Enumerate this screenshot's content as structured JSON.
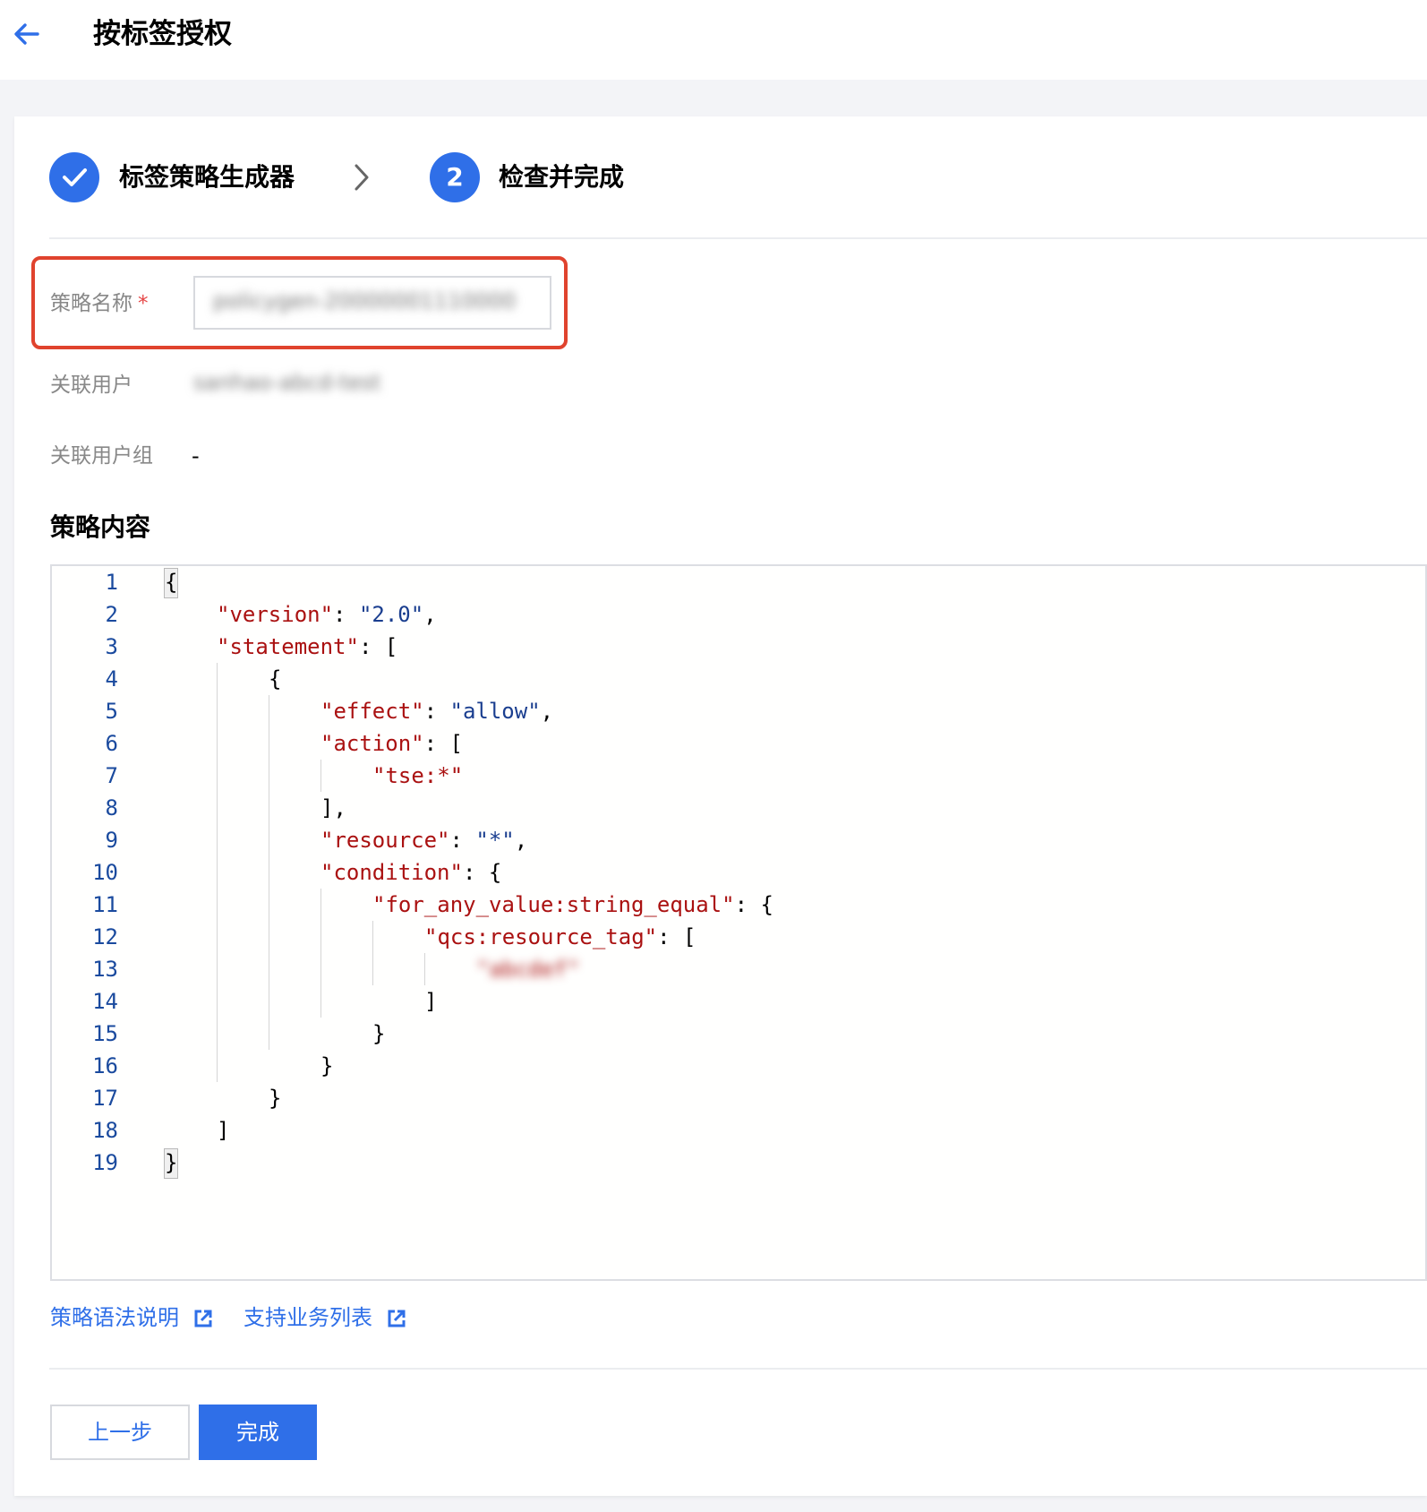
{
  "header": {
    "title": "按标签授权",
    "back_icon": "arrow-left-icon"
  },
  "steps": [
    {
      "label": "标签策略生成器",
      "state": "completed",
      "icon": "check-icon"
    },
    {
      "number": "2",
      "label": "检查并完成",
      "state": "active"
    }
  ],
  "form": {
    "policy_name_label": "策略名称",
    "required_mark": "*",
    "policy_name_value": "policygen-20000001110000",
    "related_user_label": "关联用户",
    "related_user_value": "sanhao-abcd-test",
    "related_group_label": "关联用户组",
    "related_group_value": "-"
  },
  "policy": {
    "title": "策略内容",
    "lines": [
      {
        "n": "1",
        "t": [
          [
            "p",
            "{"
          ]
        ]
      },
      {
        "n": "2",
        "t": [
          [
            "k",
            "\"version\""
          ],
          [
            "p",
            ": "
          ],
          [
            "s",
            "\"2.0\""
          ],
          [
            "p",
            ","
          ]
        ]
      },
      {
        "n": "3",
        "t": [
          [
            "k",
            "\"statement\""
          ],
          [
            "p",
            ": ["
          ]
        ]
      },
      {
        "n": "4",
        "t": [
          [
            "p",
            "{"
          ]
        ]
      },
      {
        "n": "5",
        "t": [
          [
            "k",
            "\"effect\""
          ],
          [
            "p",
            ": "
          ],
          [
            "s",
            "\"allow\""
          ],
          [
            "p",
            ","
          ]
        ]
      },
      {
        "n": "6",
        "t": [
          [
            "k",
            "\"action\""
          ],
          [
            "p",
            ": ["
          ]
        ]
      },
      {
        "n": "7",
        "t": [
          [
            "k",
            "\"tse:*\""
          ]
        ]
      },
      {
        "n": "8",
        "t": [
          [
            "p",
            "],"
          ]
        ]
      },
      {
        "n": "9",
        "t": [
          [
            "k",
            "\"resource\""
          ],
          [
            "p",
            ": "
          ],
          [
            "s",
            "\"*\""
          ],
          [
            "p",
            ","
          ]
        ]
      },
      {
        "n": "10",
        "t": [
          [
            "k",
            "\"condition\""
          ],
          [
            "p",
            ": {"
          ]
        ]
      },
      {
        "n": "11",
        "t": [
          [
            "k",
            "\"for_any_value:string_equal\""
          ],
          [
            "p",
            ": {"
          ]
        ]
      },
      {
        "n": "12",
        "t": [
          [
            "k",
            "\"qcs:resource_tag\""
          ],
          [
            "p",
            ": ["
          ]
        ]
      },
      {
        "n": "13",
        "t": [
          [
            "b",
            "\"abcdef\""
          ]
        ]
      },
      {
        "n": "14",
        "t": [
          [
            "p",
            "]"
          ]
        ]
      },
      {
        "n": "15",
        "t": [
          [
            "p",
            "}"
          ]
        ]
      },
      {
        "n": "16",
        "t": [
          [
            "p",
            "}"
          ]
        ]
      },
      {
        "n": "17",
        "t": [
          [
            "p",
            "}"
          ]
        ]
      },
      {
        "n": "18",
        "t": [
          [
            "p",
            "]"
          ]
        ]
      },
      {
        "n": "19",
        "t": [
          [
            "p",
            "}"
          ]
        ]
      }
    ]
  },
  "links": [
    {
      "label": "策略语法说明",
      "icon": "external-link-icon"
    },
    {
      "label": "支持业务列表",
      "icon": "external-link-icon"
    }
  ],
  "buttons": {
    "prev": "上一步",
    "done": "完成"
  },
  "colors": {
    "accent": "#2f6fe8",
    "highlight": "#e0432e",
    "json_key": "#aa1111",
    "json_string": "#1a3e8f"
  }
}
